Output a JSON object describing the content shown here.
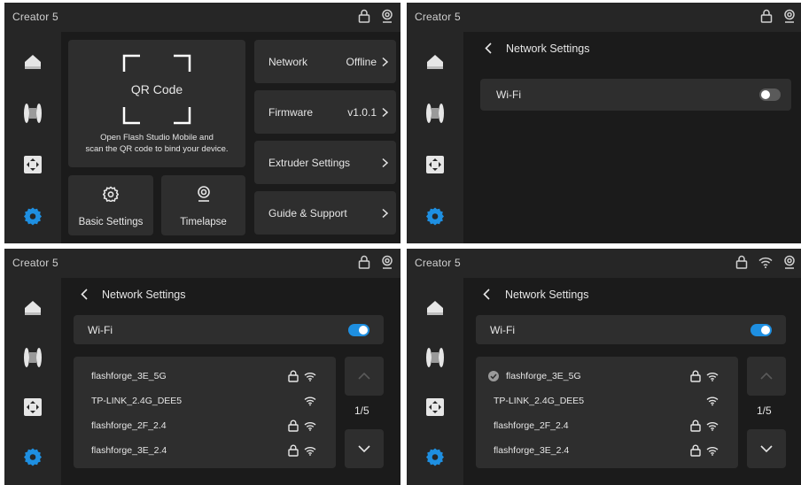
{
  "brand": "Creator 5",
  "panel1": {
    "qr": {
      "title": "QR Code",
      "desc_line1": "Open Flash Studio Mobile  and",
      "desc_line2": "scan the QR code to bind your device."
    },
    "basic_settings": "Basic Settings",
    "timelapse": "Timelapse",
    "menu": [
      {
        "label": "Network",
        "value": "Offline"
      },
      {
        "label": "Firmware",
        "value": "v1.0.1"
      },
      {
        "label": "Extruder Settings",
        "value": ""
      },
      {
        "label": "Guide & Support",
        "value": ""
      }
    ]
  },
  "network": {
    "title": "Network Settings",
    "wifi_label": "Wi-Fi",
    "wifi_off_state": "off",
    "wifi_on_state": "on",
    "networks": [
      {
        "name": "flashforge_3E_5G",
        "locked": true
      },
      {
        "name": "TP-LINK_2.4G_DEE5",
        "locked": false
      },
      {
        "name": "flashforge_2F_2.4",
        "locked": true
      },
      {
        "name": "flashforge_3E_2.4",
        "locked": true
      }
    ],
    "page": "1/5",
    "connected_network": "flashforge_3E_5G"
  },
  "icons": {
    "status": [
      "lock-icon",
      "webcam-icon",
      "wifi-icon"
    ],
    "sidebar": [
      "home-icon",
      "filament-spool-icon",
      "move-axis-icon",
      "settings-gear-icon"
    ],
    "accent": "#1e8fe1"
  }
}
